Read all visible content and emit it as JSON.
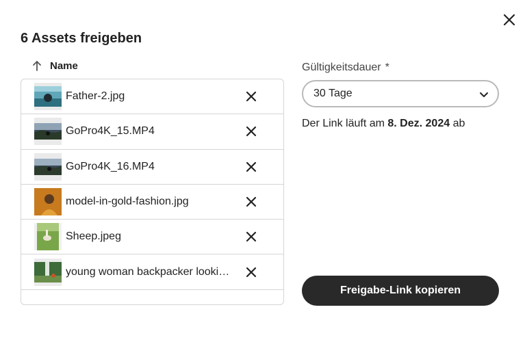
{
  "dialog": {
    "title": "6 Assets freigeben",
    "close_icon": "close-icon"
  },
  "list": {
    "column_header": "Name",
    "sort_icon": "arrow-up-icon",
    "items": [
      {
        "name": "Father-2.jpg",
        "thumb": "photo-beach"
      },
      {
        "name": "GoPro4K_15.MP4",
        "thumb": "video-landscape"
      },
      {
        "name": "GoPro4K_16.MP4",
        "thumb": "video-landscape"
      },
      {
        "name": "model-in-gold-fashion.jpg",
        "thumb": "photo-portrait"
      },
      {
        "name": "Sheep.jpeg",
        "thumb": "photo-field"
      },
      {
        "name": "young woman backpacker looki…",
        "thumb": "photo-forest"
      }
    ]
  },
  "validity": {
    "label": "Gültigkeitsdauer",
    "required_mark": "*",
    "selected": "30 Tage",
    "expiry_prefix": "Der Link läuft am",
    "expiry_date": "8. Dez. 2024",
    "expiry_suffix": "ab"
  },
  "actions": {
    "copy_link": "Freigabe-Link kopieren"
  },
  "colors": {
    "primary_button": "#292929",
    "border": "#d5d5d5",
    "text": "#222222"
  }
}
